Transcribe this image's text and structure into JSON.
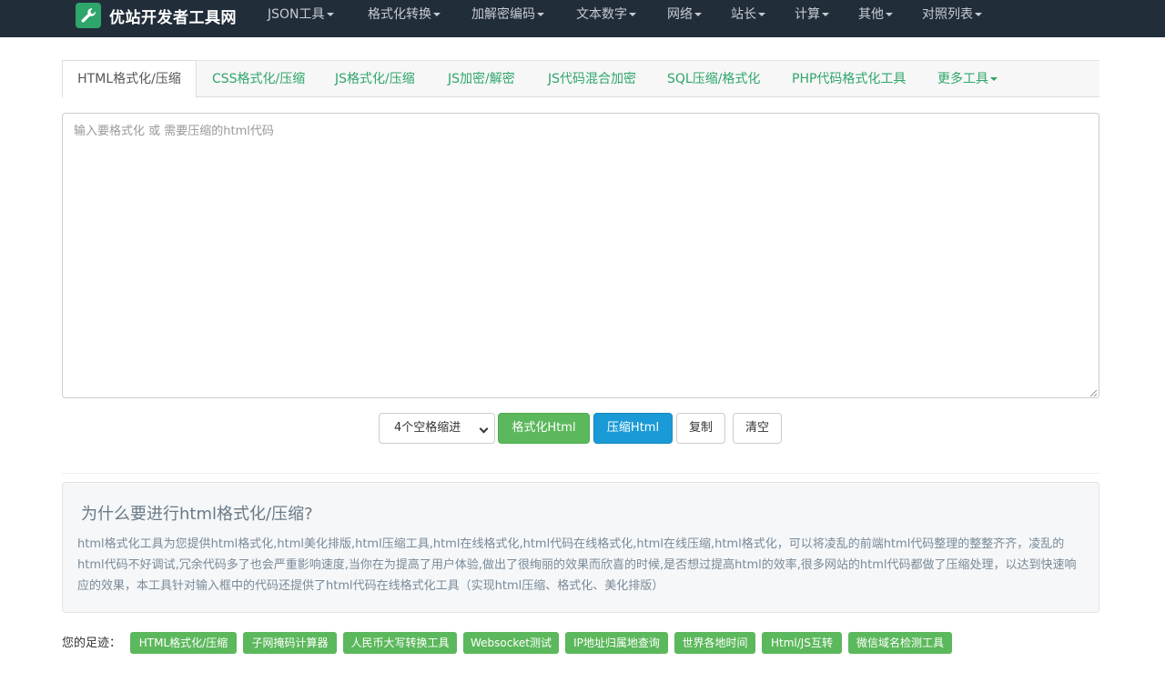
{
  "brand": {
    "name": "优站开发者工具网",
    "logo_icon": "wrench-icon",
    "logo_color": "#2ea56a"
  },
  "nav": {
    "background": "#222d3a",
    "items": [
      {
        "label": "JSON工具"
      },
      {
        "label": "格式化转换"
      },
      {
        "label": "加解密编码"
      },
      {
        "label": "文本数字"
      },
      {
        "label": "网络"
      },
      {
        "label": "站长"
      },
      {
        "label": "计算"
      },
      {
        "label": "其他"
      },
      {
        "label": "对照列表"
      }
    ]
  },
  "tabs": {
    "items": [
      {
        "label": "HTML格式化/压缩",
        "active": true
      },
      {
        "label": "CSS格式化/压缩"
      },
      {
        "label": "JS格式化/压缩"
      },
      {
        "label": "JS加密/解密"
      },
      {
        "label": "JS代码混合加密"
      },
      {
        "label": "SQL压缩/格式化"
      },
      {
        "label": "PHP代码格式化工具"
      },
      {
        "label": "更多工具"
      }
    ],
    "accent": "#2ea56a"
  },
  "editor": {
    "value": "",
    "placeholder": "输入要格式化 或 需要压缩的html代码"
  },
  "controls": {
    "indent_selected": "4个空格缩进",
    "format_label": "格式化Html",
    "compress_label": "压缩Html",
    "copy_label": "复制",
    "clear_label": "清空"
  },
  "info": {
    "title": "为什么要进行html格式化/压缩?",
    "text": "html格式化工具为您提供html格式化,html美化排版,html压缩工具,html在线格式化,html代码在线格式化,html在线压缩,html格式化，可以将凌乱的前端html代码整理的整整齐齐，凌乱的html代码不好调试,冗余代码多了也会严重影响速度,当你在为提高了用户体验,做出了很绚丽的效果而欣喜的时候,是否想过提高html的效率,很多网站的html代码都做了压缩处理，以达到快速响应的效果，本工具针对输入框中的代码还提供了html代码在线格式化工具（实现html压缩、格式化、美化排版）"
  },
  "footprint": {
    "label": "您的足迹：",
    "tags": [
      {
        "label": "HTML格式化/压缩"
      },
      {
        "label": "子网掩码计算器"
      },
      {
        "label": "人民币大写转换工具"
      },
      {
        "label": "Websocket测试"
      },
      {
        "label": "IP地址归属地查询"
      },
      {
        "label": "世界各地时间"
      },
      {
        "label": "Html/JS互转"
      },
      {
        "label": "微信域名检测工具"
      }
    ],
    "tag_color": "#5cb85c"
  }
}
